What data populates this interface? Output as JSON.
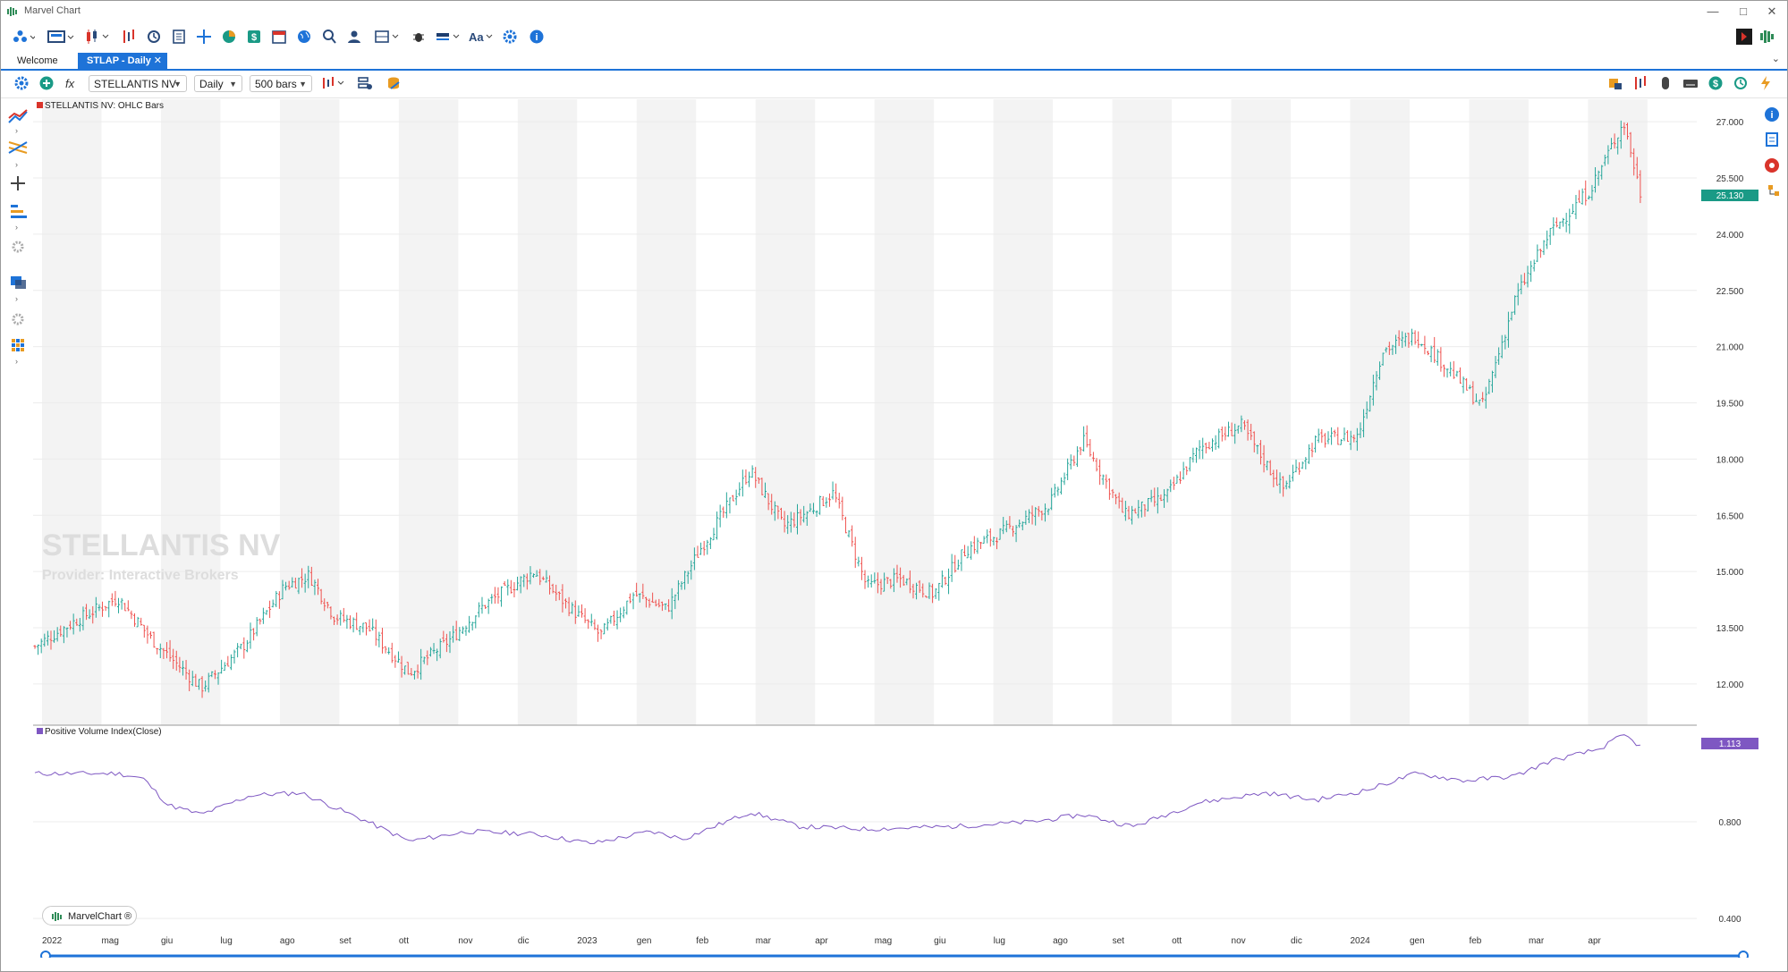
{
  "window": {
    "title": "Marvel Chart"
  },
  "tabs": [
    {
      "label": "Welcome"
    },
    {
      "label": "STLAP - Daily"
    }
  ],
  "controls": {
    "symbol": "STELLANTIS NV",
    "timeframe": "Daily",
    "bars": "500 bars"
  },
  "main_panel": {
    "legend": "STELLANTIS NV: OHLC Bars",
    "watermark": "STELLANTIS NV",
    "provider_watermark": "Provider: Interactive Brokers",
    "last_price": "25.130"
  },
  "indicator_panel": {
    "legend": "Positive Volume Index(Close)",
    "last_value": "1.113"
  },
  "brand_pill": "MarvelChart ®",
  "colors": {
    "up": "#26a69a",
    "down": "#ef5350",
    "accent": "#1e73d8",
    "price_badge": "#1a9a86",
    "indicator": "#7e57c2"
  },
  "icons": [
    "app-icon",
    "draw-tools-icon",
    "layout-icon",
    "candles-icon",
    "compare-icon",
    "history-icon",
    "document-icon",
    "crosshair-icon",
    "pie-icon",
    "dollar-icon",
    "globe-icon",
    "search-user-icon",
    "user-icon",
    "panels-icon",
    "bug-icon",
    "color-icon",
    "font-icon",
    "settings-icon",
    "info-icon"
  ],
  "chart_data": [
    {
      "type": "ohlc",
      "title": "STELLANTIS NV: OHLC Bars",
      "x_ticks": [
        "2022",
        "mag",
        "giu",
        "lug",
        "ago",
        "set",
        "ott",
        "nov",
        "dic",
        "2023",
        "gen",
        "feb",
        "mar",
        "apr",
        "mag",
        "giu",
        "lug",
        "ago",
        "set",
        "ott",
        "nov",
        "dic",
        "2024",
        "gen",
        "feb",
        "mar",
        "apr"
      ],
      "y_ticks": [
        "12.000",
        "13.500",
        "15.000",
        "16.500",
        "18.000",
        "19.500",
        "21.000",
        "22.500",
        "24.000",
        "25.500",
        "27.000"
      ],
      "ylim": [
        10.9,
        27.6
      ],
      "last": 25.13,
      "close_path": [
        {
          "x": 0,
          "y": 13.0
        },
        {
          "x": 0.025,
          "y": 13.7
        },
        {
          "x": 0.05,
          "y": 14.3
        },
        {
          "x": 0.07,
          "y": 13.2
        },
        {
          "x": 0.1,
          "y": 11.9
        },
        {
          "x": 0.125,
          "y": 13.0
        },
        {
          "x": 0.15,
          "y": 14.6
        },
        {
          "x": 0.165,
          "y": 14.9
        },
        {
          "x": 0.18,
          "y": 13.8
        },
        {
          "x": 0.2,
          "y": 13.5
        },
        {
          "x": 0.225,
          "y": 12.3
        },
        {
          "x": 0.25,
          "y": 13.2
        },
        {
          "x": 0.27,
          "y": 14.1
        },
        {
          "x": 0.3,
          "y": 15.0
        },
        {
          "x": 0.32,
          "y": 14.1
        },
        {
          "x": 0.34,
          "y": 13.3
        },
        {
          "x": 0.36,
          "y": 14.4
        },
        {
          "x": 0.38,
          "y": 14.0
        },
        {
          "x": 0.4,
          "y": 15.6
        },
        {
          "x": 0.43,
          "y": 17.7
        },
        {
          "x": 0.45,
          "y": 16.2
        },
        {
          "x": 0.465,
          "y": 16.6
        },
        {
          "x": 0.48,
          "y": 17.1
        },
        {
          "x": 0.5,
          "y": 14.6
        },
        {
          "x": 0.52,
          "y": 14.8
        },
        {
          "x": 0.54,
          "y": 14.4
        },
        {
          "x": 0.56,
          "y": 15.6
        },
        {
          "x": 0.58,
          "y": 16.0
        },
        {
          "x": 0.61,
          "y": 16.8
        },
        {
          "x": 0.63,
          "y": 18.5
        },
        {
          "x": 0.655,
          "y": 16.5
        },
        {
          "x": 0.68,
          "y": 17.0
        },
        {
          "x": 0.7,
          "y": 18.3
        },
        {
          "x": 0.725,
          "y": 18.9
        },
        {
          "x": 0.75,
          "y": 17.2
        },
        {
          "x": 0.77,
          "y": 18.5
        },
        {
          "x": 0.795,
          "y": 18.6
        },
        {
          "x": 0.81,
          "y": 20.9
        },
        {
          "x": 0.83,
          "y": 21.3
        },
        {
          "x": 0.85,
          "y": 20.4
        },
        {
          "x": 0.87,
          "y": 19.4
        },
        {
          "x": 0.89,
          "y": 22.3
        },
        {
          "x": 0.91,
          "y": 24.0
        },
        {
          "x": 0.935,
          "y": 25.2
        },
        {
          "x": 0.955,
          "y": 27.0
        },
        {
          "x": 0.965,
          "y": 25.1
        }
      ]
    },
    {
      "type": "line",
      "title": "Positive Volume Index(Close)",
      "y_ticks": [
        "0.400",
        "0.800"
      ],
      "ylim": [
        0.33,
        1.2
      ],
      "last": 1.113,
      "values": [
        {
          "x": 0,
          "y": 1.0
        },
        {
          "x": 0.05,
          "y": 1.0
        },
        {
          "x": 0.065,
          "y": 0.98
        },
        {
          "x": 0.08,
          "y": 0.87
        },
        {
          "x": 0.1,
          "y": 0.83
        },
        {
          "x": 0.13,
          "y": 0.91
        },
        {
          "x": 0.16,
          "y": 0.92
        },
        {
          "x": 0.2,
          "y": 0.8
        },
        {
          "x": 0.225,
          "y": 0.72
        },
        {
          "x": 0.26,
          "y": 0.76
        },
        {
          "x": 0.3,
          "y": 0.75
        },
        {
          "x": 0.335,
          "y": 0.71
        },
        {
          "x": 0.37,
          "y": 0.76
        },
        {
          "x": 0.39,
          "y": 0.73
        },
        {
          "x": 0.43,
          "y": 0.84
        },
        {
          "x": 0.46,
          "y": 0.78
        },
        {
          "x": 0.5,
          "y": 0.77
        },
        {
          "x": 0.55,
          "y": 0.78
        },
        {
          "x": 0.6,
          "y": 0.8
        },
        {
          "x": 0.63,
          "y": 0.83
        },
        {
          "x": 0.66,
          "y": 0.78
        },
        {
          "x": 0.7,
          "y": 0.88
        },
        {
          "x": 0.74,
          "y": 0.92
        },
        {
          "x": 0.77,
          "y": 0.89
        },
        {
          "x": 0.8,
          "y": 0.93
        },
        {
          "x": 0.83,
          "y": 1.0
        },
        {
          "x": 0.86,
          "y": 0.97
        },
        {
          "x": 0.89,
          "y": 0.99
        },
        {
          "x": 0.91,
          "y": 1.05
        },
        {
          "x": 0.94,
          "y": 1.1
        },
        {
          "x": 0.955,
          "y": 1.16
        },
        {
          "x": 0.965,
          "y": 1.113
        }
      ]
    }
  ]
}
